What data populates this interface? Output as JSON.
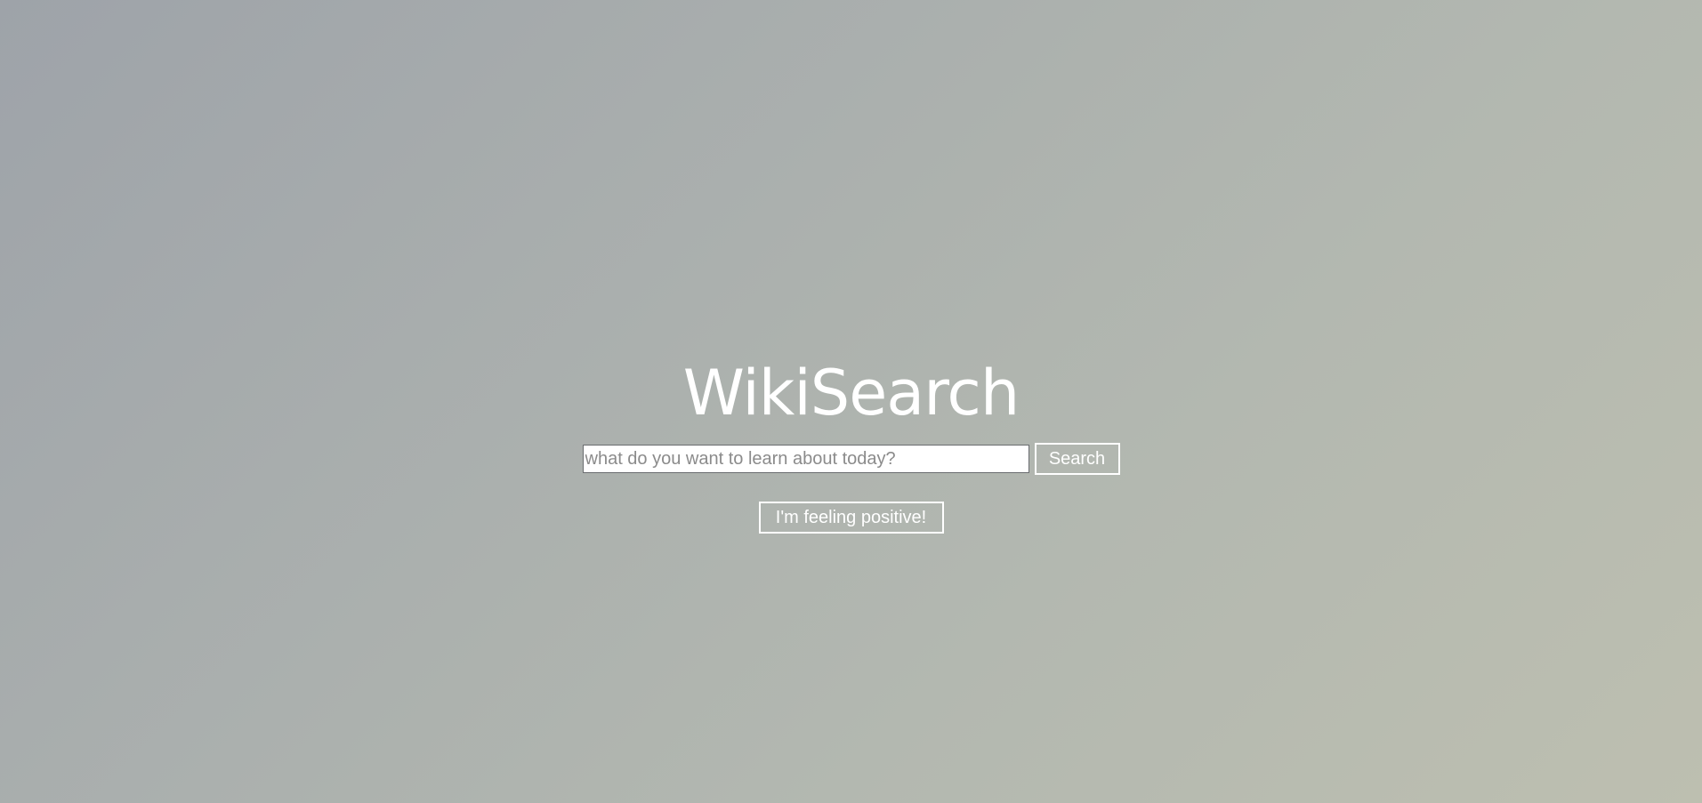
{
  "header": {
    "title": "WikiSearch"
  },
  "search": {
    "placeholder": "what do you want to learn about today?",
    "value": "",
    "button_label": "Search"
  },
  "random": {
    "button_label": "I'm feeling positive!"
  },
  "colors": {
    "text": "#ffffff",
    "background_start": "#9ea3a9",
    "background_end": "#bdbfb0"
  }
}
